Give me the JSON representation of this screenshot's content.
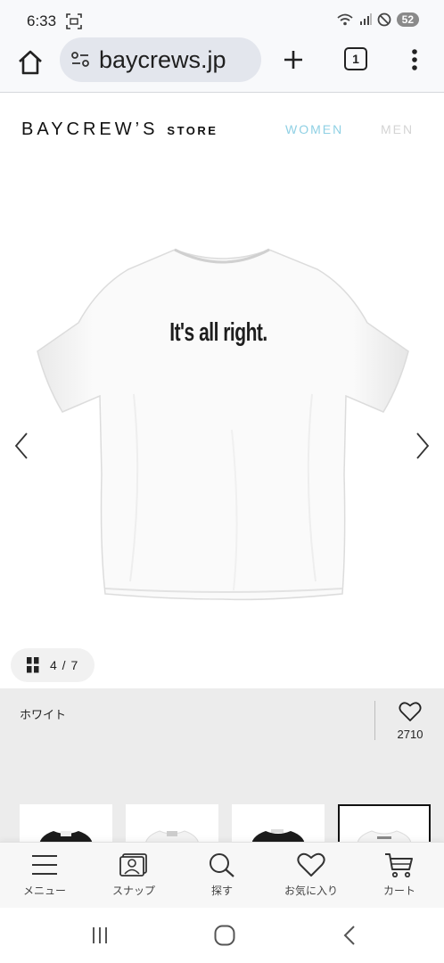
{
  "status_bar": {
    "time": "6:33",
    "battery": "52"
  },
  "browser": {
    "url": "baycrews.jp",
    "tab_count": "1"
  },
  "site": {
    "logo_main": "BAYCREW’S",
    "logo_store": "STORE",
    "nav": [
      "WOMEN",
      "MEN"
    ],
    "colors": {
      "women": "#8fd0e4",
      "men": "#d4d4d4"
    }
  },
  "product": {
    "shirt_print": "It's all right.",
    "image_counter": "4 / 7",
    "color_name": "ホワイト",
    "favorite_count": "2710",
    "thumbnails": [
      "black-tee",
      "white-tee",
      "black-tee",
      "white-tee"
    ],
    "selected_thumbnail": 3
  },
  "bottom_nav": [
    {
      "label": "メニュー",
      "icon": "hamburger-icon"
    },
    {
      "label": "スナップ",
      "icon": "snap-icon"
    },
    {
      "label": "探す",
      "icon": "search-icon"
    },
    {
      "label": "お気に入り",
      "icon": "heart-icon"
    },
    {
      "label": "カート",
      "icon": "cart-icon"
    }
  ]
}
